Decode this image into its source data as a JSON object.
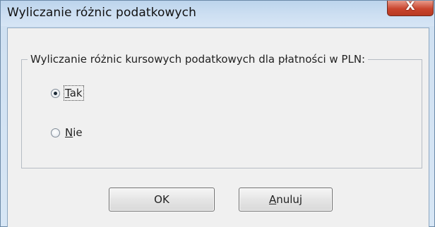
{
  "window": {
    "title": "Wyliczanie różnic podatkowych",
    "close_label": "X"
  },
  "group": {
    "legend": "Wyliczanie różnic kursowych podatkowych dla płatności w PLN:"
  },
  "options": [
    {
      "mnemonic": "T",
      "rest": "ak",
      "checked": true
    },
    {
      "mnemonic": "N",
      "rest": "ie",
      "checked": false
    }
  ],
  "buttons": {
    "ok_label": "OK",
    "cancel_mnemonic": "A",
    "cancel_rest": "nuluj"
  }
}
